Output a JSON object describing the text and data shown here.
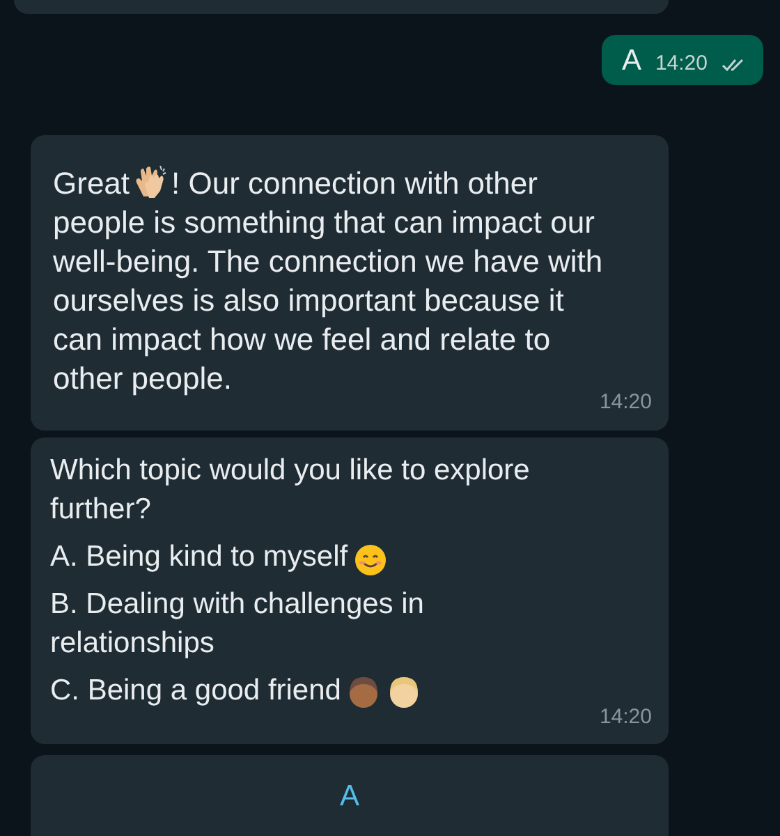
{
  "sent": {
    "text": "A",
    "time": "14:20",
    "read": false
  },
  "messages": [
    {
      "lead": "Great",
      "rest": "! Our connection with other people is something that can impact our well-being. The connection we have with ourselves is also important because it can impact how we feel and relate to other people.",
      "time": "14:20"
    },
    {
      "question": "Which topic would you like to explore further?",
      "options": [
        {
          "text": "A. Being kind to myself",
          "kind": "smile"
        },
        {
          "text": "B. Dealing with challenges in relationships",
          "kind": "plain"
        },
        {
          "text": "C. Being a good friend",
          "kind": "friends"
        }
      ],
      "time": "14:20"
    }
  ],
  "reply_button": {
    "label": "A"
  }
}
